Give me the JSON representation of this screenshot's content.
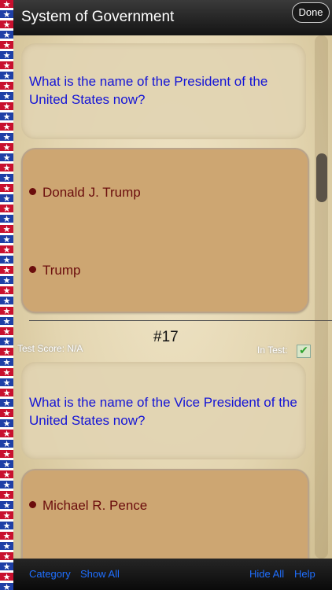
{
  "header": {
    "title": "System of Government",
    "done_label": "Done",
    "in_test_partial": "In Test:"
  },
  "question16": {
    "question": "What is the name of the President of the United States now?",
    "answers": [
      "Donald J. Trump",
      "Trump"
    ]
  },
  "question17": {
    "number": "#17",
    "test_score": "Test Score: N/A",
    "in_test_label": "In Test:",
    "question": "What is the name of the Vice President of the United States now?",
    "answers": [
      "Michael R. Pence"
    ]
  },
  "footer": {
    "category": "Category",
    "show_all": "Show All",
    "hide_all": "Hide All",
    "help": "Help"
  },
  "icons": {
    "check": "checkbox-checked-icon",
    "star": "star-icon"
  },
  "colors": {
    "question_text": "#1414d6",
    "answer_text": "#6b0d0d",
    "answer_card": "#cda672",
    "toolbar_link": "#1f6fff"
  }
}
